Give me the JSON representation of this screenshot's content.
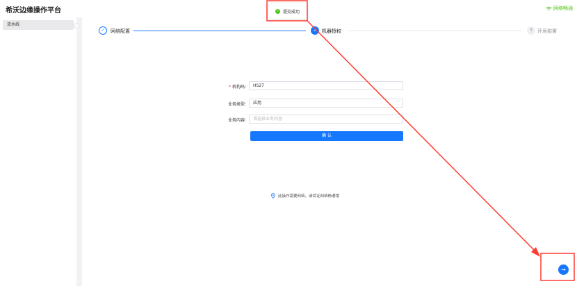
{
  "app": {
    "title": "希沃边缘操作平台"
  },
  "network": {
    "status": "网络畅通"
  },
  "toast": {
    "message": "提交成功"
  },
  "sidebar": {
    "items": [
      {
        "label": "流水线"
      }
    ],
    "collapse_glyph": "‹"
  },
  "steps": [
    {
      "label": "网络配置",
      "glyph": "✓",
      "state": "done"
    },
    {
      "label": "机器授权",
      "glyph": "2",
      "state": "active"
    },
    {
      "label": "环境部署",
      "glyph": "3",
      "state": "pending"
    }
  ],
  "form": {
    "org_code": {
      "label": "机构码:",
      "required_mark": "*",
      "value": "HS27"
    },
    "business_type": {
      "label": "业务类型:",
      "value": "应用"
    },
    "business_content": {
      "label": "业务内容:",
      "placeholder": "请选择业务内容"
    },
    "submit_label": "确 认"
  },
  "note": {
    "text": "此操作需要网络，请保证网络畅通哦"
  },
  "fab": {
    "glyph": "→"
  },
  "colors": {
    "primary": "#1677ff",
    "success": "#52c41a",
    "annotation": "#ff3b30"
  }
}
